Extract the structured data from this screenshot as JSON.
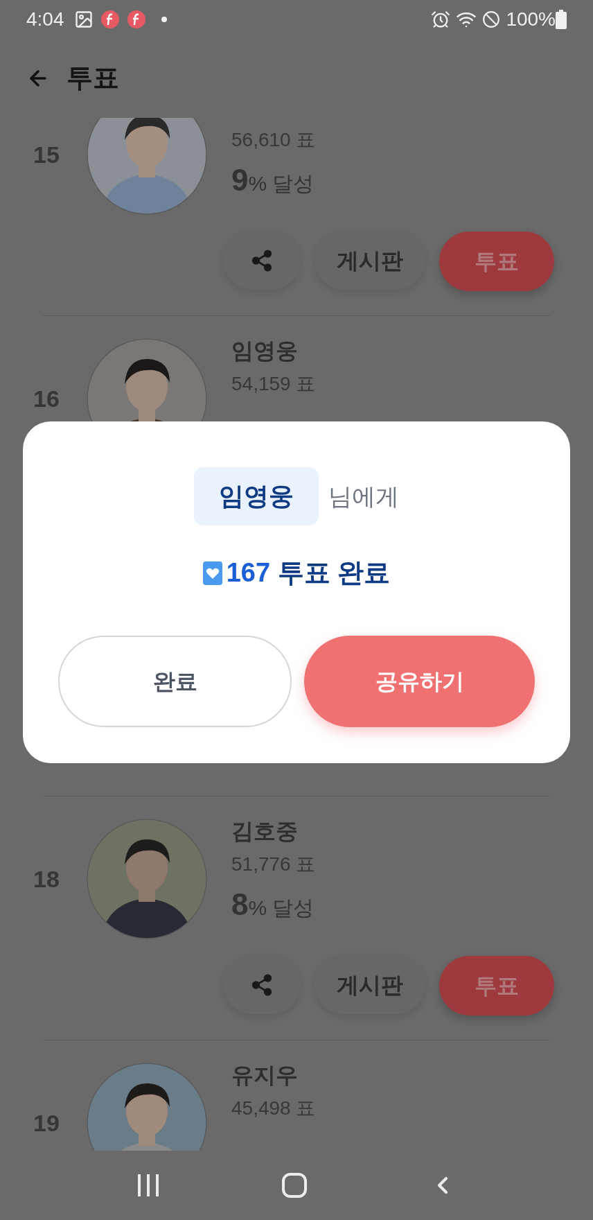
{
  "status_bar": {
    "time": "4:04",
    "battery": "100%"
  },
  "header": {
    "title": "투표"
  },
  "rows_above_dialog": [
    {
      "rank": "15",
      "votes": "56,610 표",
      "achievement": {
        "value": "9",
        "unit": "% 달성"
      },
      "actions": {
        "board": "게시판",
        "vote": "투표"
      }
    },
    {
      "rank": "16",
      "name": "임영웅",
      "votes": "54,159 표"
    }
  ],
  "dialog": {
    "recipient": "임영웅",
    "recipient_suffix": "님에게",
    "count": "167",
    "result": "투표 완료",
    "buttons": [
      {
        "label": "완료",
        "kind": "secondary"
      },
      {
        "label": "공유하기",
        "kind": "primary"
      }
    ]
  },
  "rows_below_dialog": [
    {
      "rank": "18",
      "name": "김호중",
      "votes": "51,776 표",
      "achievement": {
        "value": "8",
        "unit": "% 달성"
      },
      "actions": {
        "board": "게시판",
        "vote": "투표"
      }
    },
    {
      "rank": "19",
      "name": "유지우",
      "votes": "45,498 표"
    }
  ]
}
